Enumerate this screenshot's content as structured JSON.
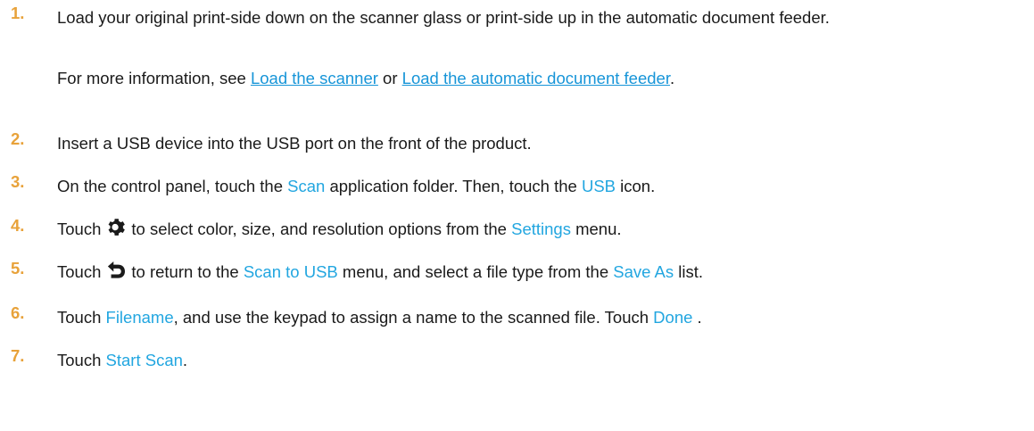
{
  "steps": [
    {
      "number": "1.",
      "text": "Load your original print-side down on the scanner glass or print-side up in the automatic document feeder."
    },
    {
      "number": "2.",
      "text": "Insert a USB device into the USB port on the front of the product."
    },
    {
      "number": "3.",
      "pre": "On the control panel, touch the ",
      "ui1": "Scan",
      "mid": " application folder. Then, touch the ",
      "ui2": "USB",
      "post": " icon."
    },
    {
      "number": "4.",
      "pre": "Touch",
      "icon": "settings-gear-icon",
      "mid": "to select color, size, and resolution options from the ",
      "ui1": "Settings",
      "post": " menu."
    },
    {
      "number": "5.",
      "pre": "Touch",
      "icon": "back-arrow-icon",
      "mid": "to return to the ",
      "ui1": "Scan to USB",
      "mid2": " menu, and select a file type from the ",
      "ui2": "Save As",
      "post": " list."
    },
    {
      "number": "6.",
      "pre": "Touch ",
      "ui1": "Filename",
      "mid": ", and use the keypad to assign a name to the scanned file. Touch ",
      "ui2": "Done",
      "post": " ."
    },
    {
      "number": "7.",
      "pre": "Touch ",
      "ui1": "Start Scan",
      "post": "."
    }
  ],
  "note": {
    "pre": "For more information, see ",
    "link1": "Load the scanner",
    "mid": " or ",
    "link2": "Load the automatic document feeder",
    "post": "."
  },
  "colors": {
    "step_number": "#e8a23a",
    "ui_term": "#22a6e0",
    "link": "#1795d8",
    "text": "#1a1a1a"
  }
}
